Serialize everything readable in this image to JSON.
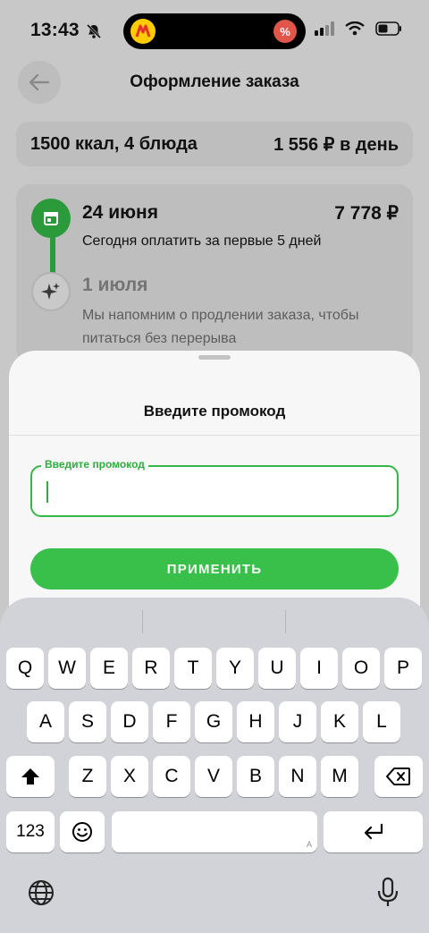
{
  "status_bar": {
    "time": "13:43",
    "discount_icon": "%"
  },
  "header": {
    "title": "Оформление заказа"
  },
  "summary": {
    "plan": "1500 ккал, 4 блюда",
    "price_per_day": "1 556 ₽ в день"
  },
  "schedule": {
    "first": {
      "date": "24 июня",
      "amount": "7 778 ₽",
      "note": "Сегодня оплатить за первые 5 дней"
    },
    "second": {
      "date": "1 июля",
      "note": "Мы напомним о продлении заказа, чтобы питаться без перерыва"
    }
  },
  "promo_sheet": {
    "title": "Введите промокод",
    "field_label": "Введите промокод",
    "field_value": "",
    "apply_label": "ПРИМЕНИТЬ"
  },
  "keyboard": {
    "row1": [
      "Q",
      "W",
      "E",
      "R",
      "T",
      "Y",
      "U",
      "I",
      "O",
      "P"
    ],
    "row2": [
      "A",
      "S",
      "D",
      "F",
      "G",
      "H",
      "J",
      "K",
      "L"
    ],
    "row3": [
      "Z",
      "X",
      "C",
      "V",
      "B",
      "N",
      "M"
    ],
    "numbers_key": "123",
    "space_hint": "A"
  },
  "colors": {
    "accent": "#39c04a",
    "accent_dark": "#2a9a3b"
  }
}
